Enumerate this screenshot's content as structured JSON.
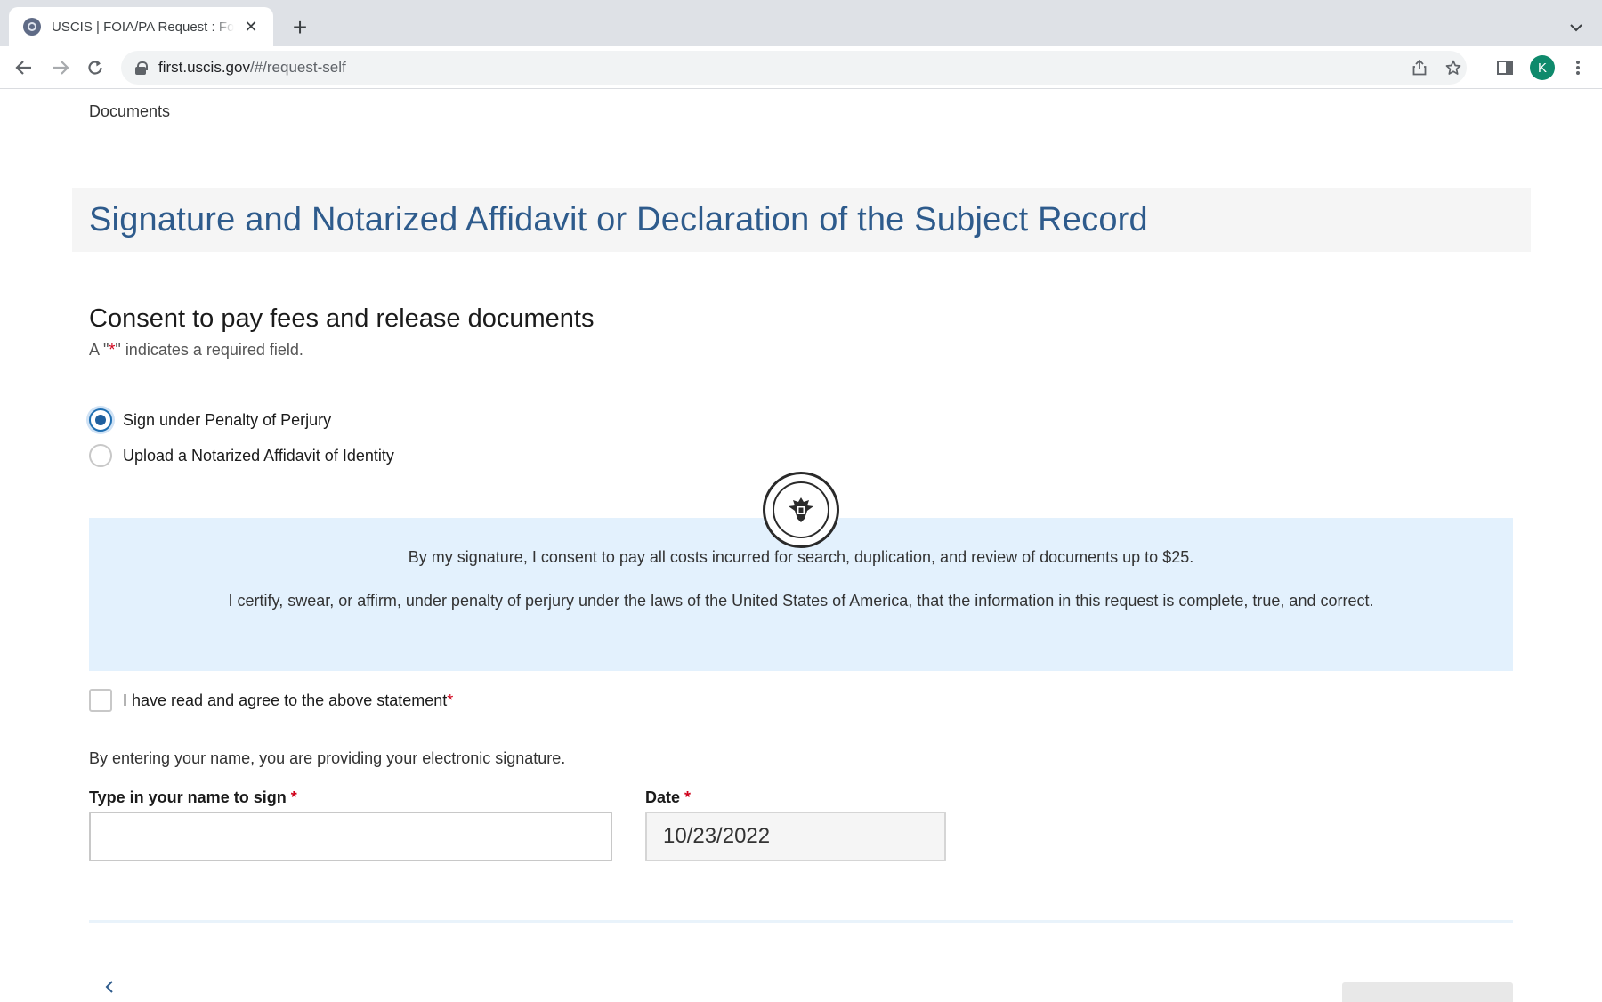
{
  "browser": {
    "tab_title": "USCIS | FOIA/PA Request : Form",
    "tab_close_glyph": "✕",
    "new_tab_glyph": "+",
    "url_host": "first.uscis.gov",
    "url_path": "/#/request-self",
    "profile_initial": "K",
    "profile_color": "#0f8a6c"
  },
  "page": {
    "breadcrumb_link": "Documents",
    "title": "Signature and Notarized Affidavit or Declaration of the Subject Record",
    "section_title": "Consent to pay fees and release documents",
    "required_note_prefix": "A \"",
    "required_note_star": "*",
    "required_note_suffix": "\" indicates a required field.",
    "signature_options": [
      {
        "label": "Sign under Penalty of Perjury",
        "selected": true
      },
      {
        "label": "Upload a Notarized Affidavit of Identity",
        "selected": false
      }
    ],
    "seal_icon": "dhs-seal-icon",
    "consent_statements": [
      "By my signature, I consent to pay all costs incurred for search, duplication, and review of documents up to $25.",
      "I certify, swear, or affirm, under penalty of perjury under the laws of the United States of America, that the information in this request is complete, true, and correct."
    ],
    "agree_label": "I have read and agree to the above statement",
    "agree_checked": false,
    "esignature_note": "By entering your name, you are providing your electronic signature.",
    "name_field": {
      "label": "Type in your name to sign",
      "value": ""
    },
    "date_field": {
      "label": "Date",
      "value": "10/23/2022"
    },
    "required_star": "*"
  },
  "colors": {
    "title_blue": "#2e5b8c",
    "consent_bg": "#e3f1fd",
    "radio_selected": "#1f5f9e",
    "required_red": "#d0021b"
  }
}
